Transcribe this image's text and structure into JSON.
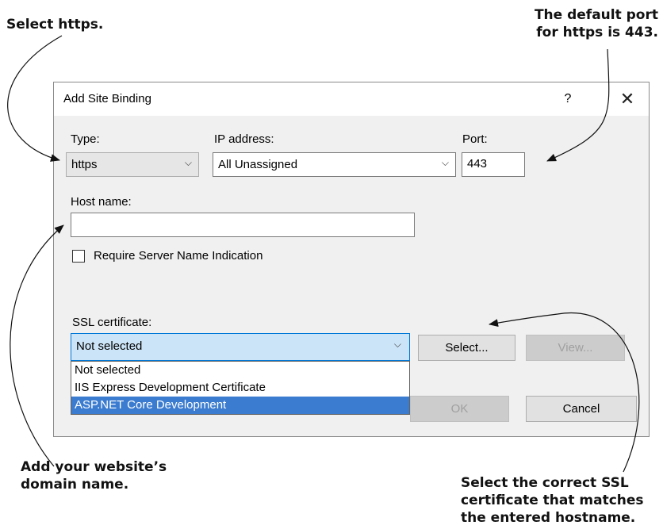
{
  "callouts": {
    "select_https": "Select https.",
    "default_port_line1": "The default port",
    "default_port_line2": "for https is 443.",
    "domain_line1": "Add your website’s",
    "domain_line2": "domain name.",
    "ssl_line1": "Select the correct SSL",
    "ssl_line2": "certificate that matches",
    "ssl_line3": "the entered hostname."
  },
  "dialog": {
    "title": "Add Site Binding",
    "help_label": "?",
    "close_label": "✕",
    "type_label": "Type:",
    "type_value": "https",
    "ip_label": "IP address:",
    "ip_value": "All Unassigned",
    "port_label": "Port:",
    "port_value": "443",
    "host_label": "Host name:",
    "host_value": "",
    "sni_label": "Require Server Name Indication",
    "sni_checked": false,
    "ssl_label": "SSL certificate:",
    "ssl_value": "Not selected",
    "ssl_options": [
      "Not selected",
      "IIS Express Development Certificate",
      "ASP.NET Core Development"
    ],
    "ssl_highlighted_option": "ASP.NET Core Development",
    "select_button": "Select...",
    "view_button": "View...",
    "ok_button": "OK",
    "cancel_button": "Cancel"
  },
  "icons": {
    "dropdown_chevron": "⌵"
  }
}
